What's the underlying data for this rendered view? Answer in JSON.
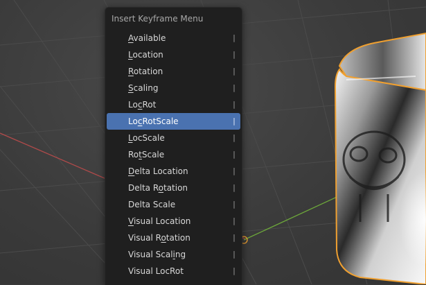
{
  "menu": {
    "title": "Insert Keyframe Menu",
    "items": [
      {
        "pre": "",
        "u": "A",
        "post": "vailable",
        "key": "|"
      },
      {
        "pre": "",
        "u": "L",
        "post": "ocation",
        "key": "|"
      },
      {
        "pre": "",
        "u": "R",
        "post": "otation",
        "key": "|"
      },
      {
        "pre": "",
        "u": "S",
        "post": "caling",
        "key": "|"
      },
      {
        "pre": "Lo",
        "u": "c",
        "post": "Rot",
        "key": "|"
      },
      {
        "pre": "Lo",
        "u": "c",
        "post": "RotScale",
        "key": "|",
        "active": true
      },
      {
        "pre": "",
        "u": "L",
        "post": "ocScale",
        "key": "|"
      },
      {
        "pre": "Ro",
        "u": "t",
        "post": "Scale",
        "key": "|"
      },
      {
        "pre": "",
        "u": "D",
        "post": "elta Location",
        "key": "|"
      },
      {
        "pre": "Delta R",
        "u": "o",
        "post": "tation",
        "key": "|"
      },
      {
        "pre": "Delta Scale",
        "u": "",
        "post": "",
        "key": "|"
      },
      {
        "pre": "",
        "u": "V",
        "post": "isual Location",
        "key": "|"
      },
      {
        "pre": "Visual R",
        "u": "o",
        "post": "tation",
        "key": "|"
      },
      {
        "pre": "Visual Scal",
        "u": "i",
        "post": "ng",
        "key": "|"
      },
      {
        "pre": "Visual LocRot",
        "u": "",
        "post": "",
        "key": "|"
      }
    ]
  },
  "colors": {
    "menu_bg": "#1f1f1f",
    "highlight": "#4a72b0",
    "selection_outline": "#f0a030",
    "x_axis": "#b04a4a",
    "y_axis": "#6da83a"
  }
}
